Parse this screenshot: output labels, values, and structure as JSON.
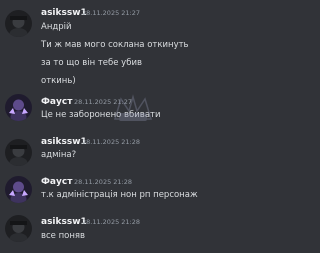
{
  "messages": [
    {
      "author": "asikssw1",
      "time": "28.11.2025 21:27",
      "lines": [
        "Андрій",
        "Ти ж мав мого соклана откинуть",
        "за то що він тебе убив",
        "откинь)"
      ]
    },
    {
      "author": "Фауст",
      "time": "28.11.2025 21:27",
      "lines": [
        "Це не заборонено вбивати"
      ]
    },
    {
      "author": "asikssw1",
      "time": "28.11.2025 21:28",
      "lines": [
        "адміна?"
      ]
    },
    {
      "author": "Фауст",
      "time": "28.11.2025 21:28",
      "lines": [
        "т.к адміністрація нон рп персонаж"
      ]
    },
    {
      "author": "asikssw1",
      "time": "28.11.2025 21:28",
      "lines": [
        "все поняв"
      ]
    }
  ],
  "colors": {
    "background": "#313338",
    "author": "#f2f3f5",
    "timestamp": "#949ba4",
    "text": "#dbdee1"
  },
  "icons": {
    "asikssw1_avatar": "user-avatar-icon",
    "faust_avatar": "user-avatar-icon"
  }
}
